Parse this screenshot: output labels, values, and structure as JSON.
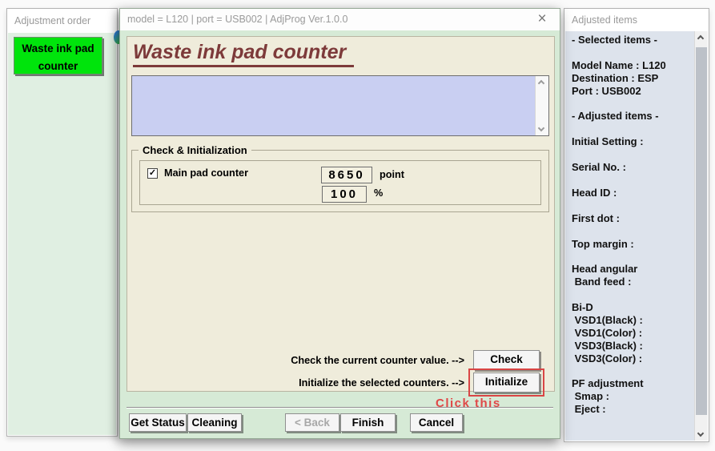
{
  "left_panel": {
    "title": "Adjustment order",
    "order_button_label": "Waste ink pad counter"
  },
  "dialog": {
    "title": "model = L120 | port = USB002 | AdjProg Ver.1.0.0",
    "close_glyph": "×",
    "heading": "Waste ink pad counter",
    "check_group": {
      "legend": "Check & Initialization",
      "checkbox_glyph": "✓",
      "checkbox_checked": true,
      "checkbox_label": "Main pad counter",
      "counter_value": "8650",
      "counter_unit": "point",
      "percent_value": "100",
      "percent_unit": "%"
    },
    "actions": {
      "check_label": "Check the current counter value. -->",
      "check_button": "Check",
      "init_label": "Initialize the selected counters. -->",
      "init_button": "Initialize",
      "annotation": "Click this"
    },
    "footer_buttons": [
      {
        "label": "Get Status",
        "enabled": true
      },
      {
        "label": "Cleaning",
        "enabled": true
      },
      {
        "label": "< Back",
        "enabled": false
      },
      {
        "label": "Finish",
        "enabled": true
      },
      {
        "label": "Cancel",
        "enabled": true
      }
    ]
  },
  "right_panel": {
    "title": "Adjusted items",
    "lines": [
      "- Selected items -",
      "",
      "Model Name : L120",
      "Destination : ESP",
      "Port : USB002",
      "",
      "- Adjusted items -",
      "",
      "Initial Setting :",
      "",
      "Serial No. :",
      "",
      "Head ID :",
      "",
      "First dot :",
      "",
      "Top margin :",
      "",
      "Head angular",
      " Band feed :",
      "",
      "Bi-D",
      " VSD1(Black) :",
      " VSD1(Color) :",
      " VSD3(Black) :",
      " VSD3(Color) :",
      "",
      "PF adjustment",
      " Smap :",
      " Eject :"
    ]
  },
  "colors": {
    "highlight_red": "#d94545",
    "annotation_red": "#e04848",
    "heading_maroon": "#7d3a3a",
    "order_button_green": "#00e40c",
    "notice_area_blue": "#c9cff2",
    "dialog_frame_green": "#d6ead6",
    "content_beige": "#efecdb"
  }
}
